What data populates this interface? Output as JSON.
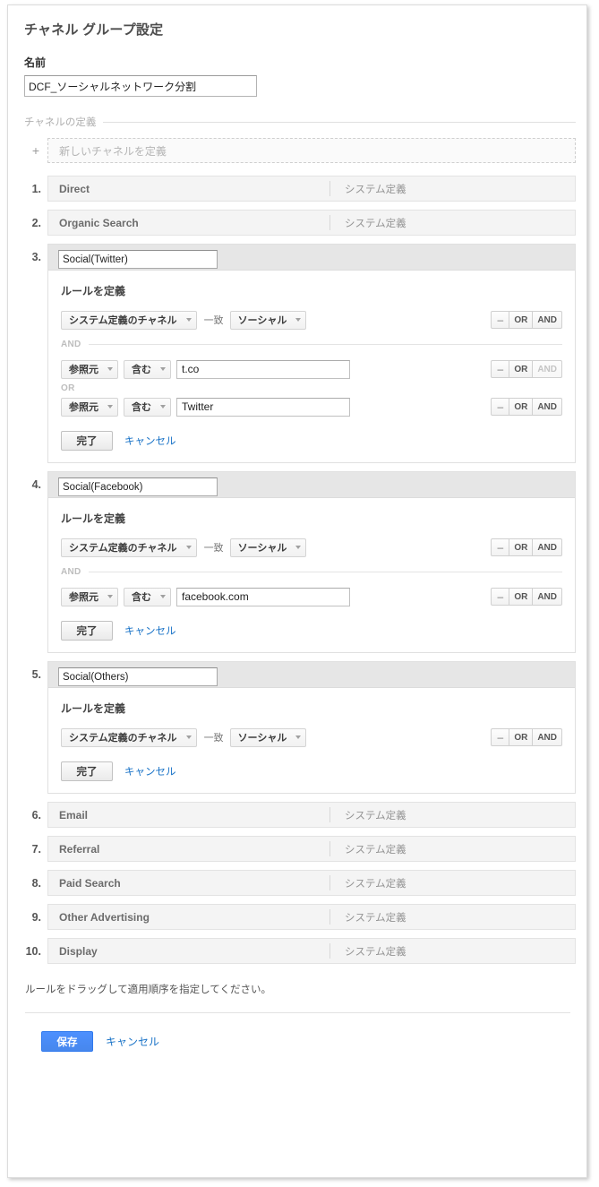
{
  "page": {
    "title": "チャネル グループ設定",
    "name_field_label": "名前",
    "name_field_value": "DCF_ソーシャルネットワーク分割",
    "section_legend": "チャネルの定義",
    "new_channel_placeholder": "新しいチャネルを定義",
    "plus_icon": "+",
    "system_defined_tag": "システム定義",
    "rules_title": "ルールを定義",
    "done_label": "完了",
    "cancel_label": "キャンセル",
    "match_word": "一致",
    "minus_label": "–",
    "or_label": "OR",
    "and_label": "AND",
    "hint": "ルールをドラッグして適用順序を指定してください。",
    "save_label": "保存",
    "footer_cancel_label": "キャンセル"
  },
  "colors": {
    "accent_blue": "#4d90fe",
    "link_blue": "#1a73c7",
    "row_gray": "#f4f4f4",
    "header_gray": "#e6e6e6",
    "muted_text": "#949494"
  },
  "channels": [
    {
      "index": "1.",
      "name": "Direct",
      "type": "system"
    },
    {
      "index": "2.",
      "name": "Organic Search",
      "type": "system"
    },
    {
      "index": "3.",
      "name": "Social(Twitter)",
      "type": "editing",
      "rules": [
        {
          "conjunction": null,
          "kind": "dimension-match",
          "dimension": "システム定義のチャネル",
          "match_word": "一致",
          "value_select": "ソーシャル",
          "buttons": {
            "minus": "–",
            "or": "OR",
            "and": "AND",
            "and_disabled": false
          }
        },
        {
          "conjunction": "AND",
          "conjunction_style": "rule",
          "kind": "text",
          "dimension": "参照元",
          "operator": "含む",
          "value": "t.co",
          "buttons": {
            "minus": "–",
            "or": "OR",
            "and": "AND",
            "and_disabled": true
          }
        },
        {
          "conjunction": "OR",
          "conjunction_style": "plain",
          "kind": "text",
          "dimension": "参照元",
          "operator": "含む",
          "value": "Twitter",
          "buttons": {
            "minus": "–",
            "or": "OR",
            "and": "AND",
            "and_disabled": false
          }
        }
      ]
    },
    {
      "index": "4.",
      "name": "Social(Facebook)",
      "type": "editing",
      "rules": [
        {
          "conjunction": null,
          "kind": "dimension-match",
          "dimension": "システム定義のチャネル",
          "match_word": "一致",
          "value_select": "ソーシャル",
          "buttons": {
            "minus": "–",
            "or": "OR",
            "and": "AND",
            "and_disabled": false
          }
        },
        {
          "conjunction": "AND",
          "conjunction_style": "rule",
          "kind": "text",
          "dimension": "参照元",
          "operator": "含む",
          "value": "facebook.com",
          "buttons": {
            "minus": "–",
            "or": "OR",
            "and": "AND",
            "and_disabled": false
          }
        }
      ]
    },
    {
      "index": "5.",
      "name": "Social(Others)",
      "type": "editing",
      "rules": [
        {
          "conjunction": null,
          "kind": "dimension-match",
          "dimension": "システム定義のチャネル",
          "match_word": "一致",
          "value_select": "ソーシャル",
          "buttons": {
            "minus": "–",
            "or": "OR",
            "and": "AND",
            "and_disabled": false
          }
        }
      ]
    },
    {
      "index": "6.",
      "name": "Email",
      "type": "system"
    },
    {
      "index": "7.",
      "name": "Referral",
      "type": "system"
    },
    {
      "index": "8.",
      "name": "Paid Search",
      "type": "system"
    },
    {
      "index": "9.",
      "name": "Other Advertising",
      "type": "system"
    },
    {
      "index": "10.",
      "name": "Display",
      "type": "system"
    }
  ]
}
